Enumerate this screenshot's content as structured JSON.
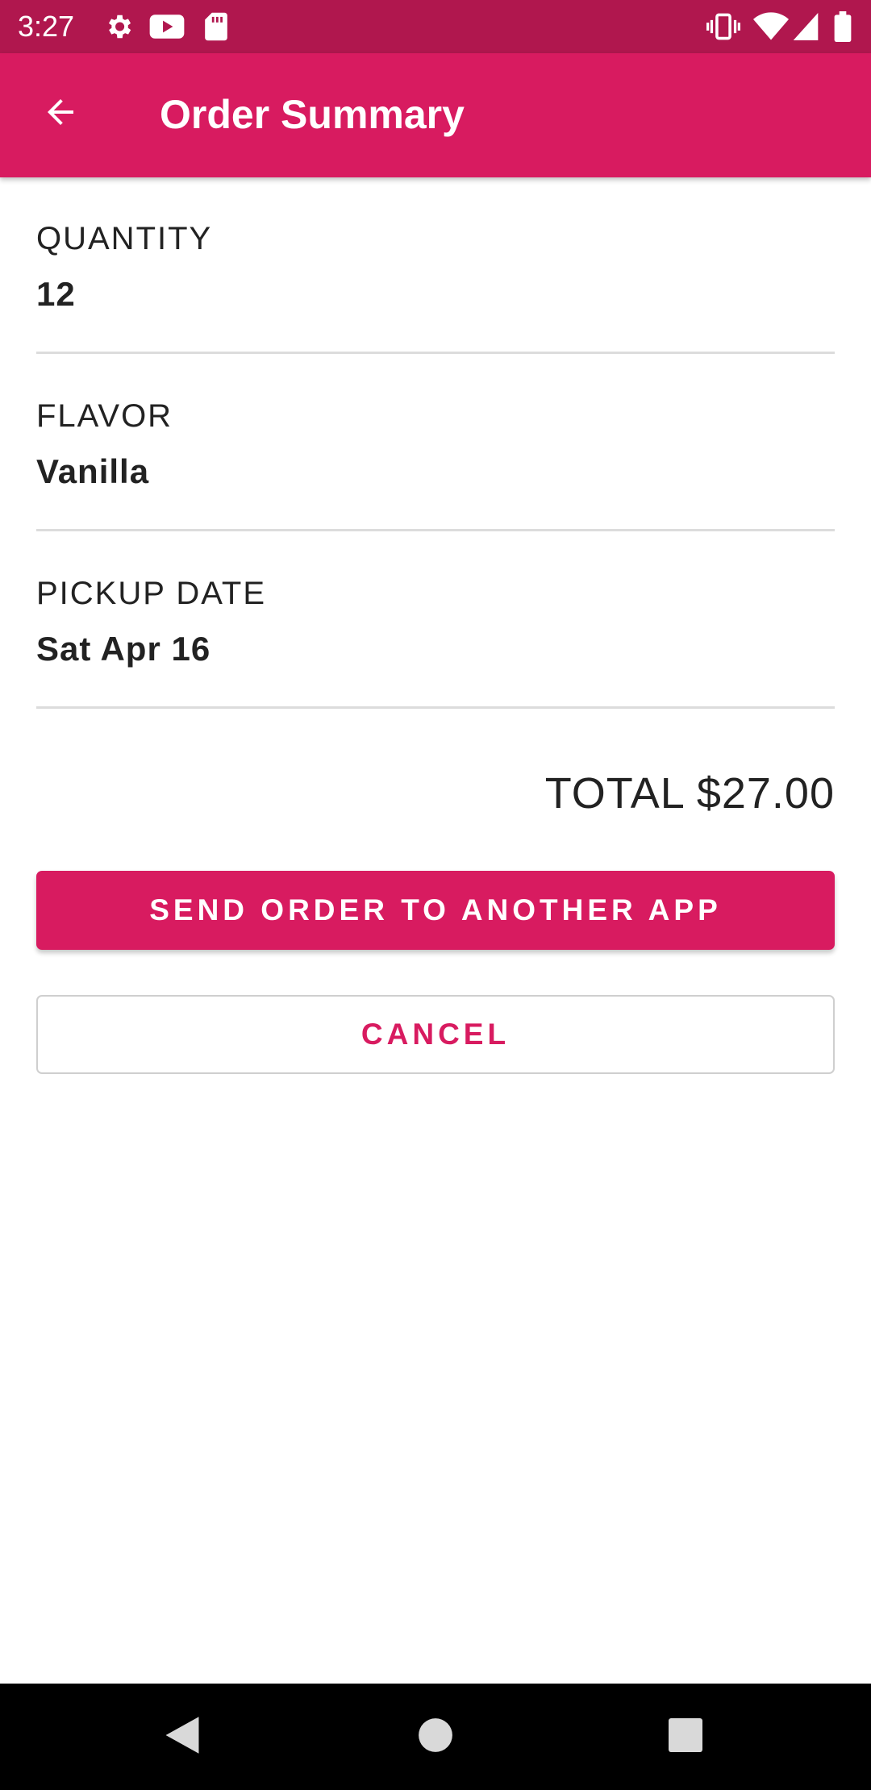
{
  "status_bar": {
    "time": "3:27",
    "icons_left": [
      "gear-icon",
      "youtube-icon",
      "sd-card-icon"
    ],
    "icons_right": [
      "vibrate-icon",
      "wifi-icon",
      "signal-icon",
      "battery-icon"
    ]
  },
  "app_bar": {
    "title": "Order Summary",
    "back_icon": "arrow-back-icon"
  },
  "summary": {
    "quantity_label": "QUANTITY",
    "quantity_value": "12",
    "flavor_label": "FLAVOR",
    "flavor_value": "Vanilla",
    "pickup_label": "PICKUP DATE",
    "pickup_value": "Sat Apr 16",
    "total": "TOTAL $27.00"
  },
  "actions": {
    "send_label": "SEND ORDER TO ANOTHER APP",
    "cancel_label": "CANCEL"
  },
  "nav_bar": {
    "icons": [
      "back-triangle-icon",
      "home-circle-icon",
      "recents-square-icon"
    ]
  },
  "colors": {
    "primary": "#d81b60",
    "status_bar": "#b0174e",
    "divider": "#dcdcdc"
  }
}
